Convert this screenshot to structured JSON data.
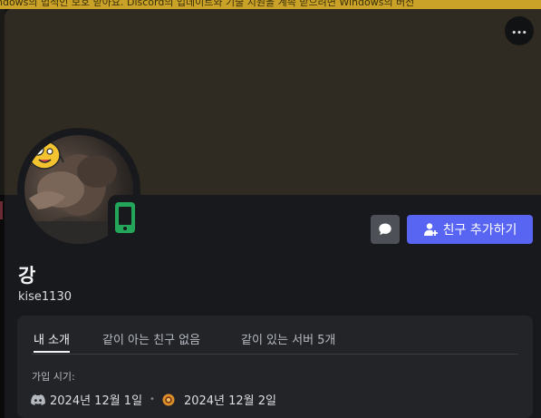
{
  "top_notice": "ndows의 법적인 보호 받아요. Discord의 업데이트와 기술 지원을 계속 받으려면 Windows의 버전",
  "more_label": "•••",
  "buttons": {
    "add_friend": "친구 추가하기"
  },
  "profile": {
    "display_name": "강",
    "username": "kise1130"
  },
  "tabs": [
    {
      "label": "내 소개",
      "active": true
    },
    {
      "label": "같이 아는 친구 없음",
      "active": false
    },
    {
      "label": "같이 있는 서버 5개",
      "active": false
    }
  ],
  "member_since": {
    "label": "가입 시기:",
    "discord_date": "2024년 12월 1일",
    "separator": "•",
    "server_date": "2024년 12월 2일"
  },
  "colors": {
    "accent": "#5865f2",
    "banner": "#2f2b22",
    "status_mobile": "#23a55a",
    "notice_bar": "#c9a227"
  },
  "icons": [
    "ellipsis-icon",
    "mobile-status-icon",
    "chat-bubble-icon",
    "add-friend-icon",
    "discord-icon",
    "server-icon"
  ]
}
